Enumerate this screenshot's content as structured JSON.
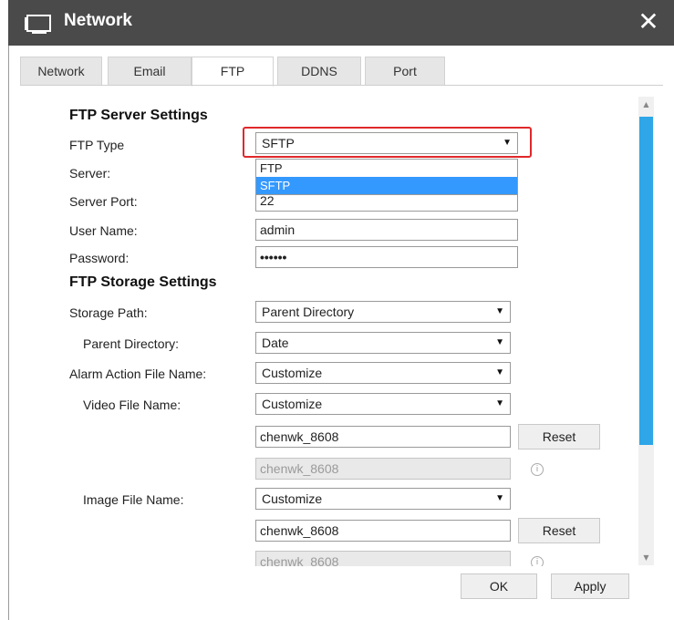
{
  "window": {
    "title": "Network",
    "close_label": "✕"
  },
  "tabs": [
    {
      "label": "Network"
    },
    {
      "label": "Email"
    },
    {
      "label": "FTP"
    },
    {
      "label": "DDNS"
    },
    {
      "label": "Port"
    }
  ],
  "active_tab": "FTP",
  "ftp_server": {
    "section_title": "FTP Server Settings",
    "ftp_type_label": "FTP Type",
    "ftp_type_value": "SFTP",
    "ftp_type_options": [
      "FTP",
      "SFTP"
    ],
    "ftp_type_highlighted": "SFTP",
    "server_label": "Server:",
    "server_port_label": "Server Port:",
    "server_port_value": "22",
    "user_name_label": "User Name:",
    "user_name_value": "admin",
    "password_label": "Password:",
    "password_value": "••••••"
  },
  "ftp_storage": {
    "section_title": "FTP Storage Settings",
    "storage_path_label": "Storage Path:",
    "storage_path_value": "Parent Directory",
    "parent_directory_label": "Parent Directory:",
    "parent_directory_value": "Date",
    "alarm_action_label": "Alarm Action File Name:",
    "alarm_action_value": "Customize",
    "video_file_label": "Video File Name:",
    "video_file_value": "Customize",
    "video_custom_input": "chenwk_8608",
    "video_preview": "chenwk_8608",
    "image_file_label": "Image File Name:",
    "image_file_value": "Customize",
    "image_custom_input": "chenwk_8608",
    "image_preview": "chenwk_8608",
    "reset_label": "Reset"
  },
  "footer": {
    "ok_label": "OK",
    "apply_label": "Apply"
  },
  "colors": {
    "titlebar": "#4a4a4a",
    "accent": "#2ea6e8",
    "highlight": "#e0282a",
    "selected_option": "#3399ff"
  }
}
